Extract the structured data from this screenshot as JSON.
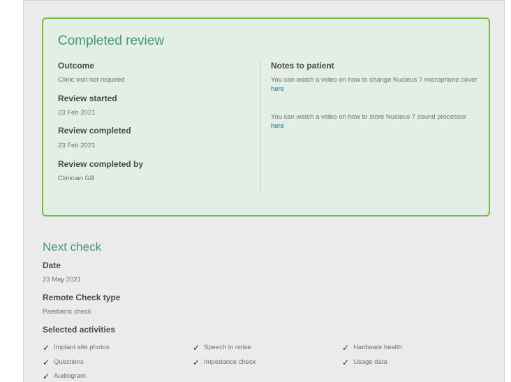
{
  "completed_review": {
    "title": "Completed review",
    "outcome_label": "Outcome",
    "outcome_value": "Clinic visit not required",
    "started_label": "Review started",
    "started_value": "23 Feb 2021",
    "completed_label": "Review completed",
    "completed_value": "23 Feb 2021",
    "completed_by_label": "Review completed by",
    "completed_by_value": "Clinician GB",
    "notes_label": "Notes to patient",
    "notes": [
      {
        "text": "You can watch a video on how to change Nucleus 7 microphone cover",
        "link": "here"
      },
      {
        "text": "You can watch a video on how to store Nucleus 7 sound processor",
        "link": "here"
      }
    ]
  },
  "next_check": {
    "title": "Next check",
    "date_label": "Date",
    "date_value": "23 May 2021",
    "type_label": "Remote Check type",
    "type_value": "Paediatric check",
    "activities_label": "Selected activities",
    "activities": [
      {
        "label": "Implant site photos",
        "icon": "check-icon"
      },
      {
        "label": "Questions",
        "icon": "check-icon"
      },
      {
        "label": "Audiogram",
        "icon": "check-icon"
      },
      {
        "label": "Speech in noise",
        "icon": "check-icon"
      },
      {
        "label": "Impedance check",
        "icon": "check-icon"
      },
      {
        "label": "Hardware health",
        "icon": "check-icon"
      },
      {
        "label": "Usage data",
        "icon": "check-icon"
      }
    ]
  },
  "colors": {
    "accent_green": "#3f9a6f",
    "card_border": "#78be3c",
    "link": "#1e6a83"
  }
}
